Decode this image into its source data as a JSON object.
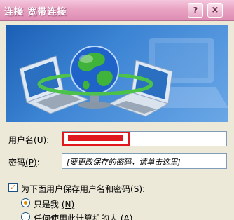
{
  "window": {
    "title": "连接 宽带连接",
    "help_label": "?",
    "close_label": "×"
  },
  "form": {
    "username_label": "用户名",
    "username_hotkey": "(U)",
    "username_value": "",
    "password_label": "密码",
    "password_hotkey": "(P)",
    "password_placeholder": "[要更改保存的密码，请单击这里]",
    "save_checkbox_label": "为下面用户保存用户名和密码",
    "save_checkbox_hotkey": "(S)",
    "save_checked": true,
    "radio_me_label": "只是我",
    "radio_me_hotkey": "(N)",
    "radio_anyone_label": "任何使用此计算机的人",
    "radio_anyone_hotkey": "(A)"
  },
  "colors": {
    "title_bar": "#e9a3c3",
    "banner": "#2f74c8",
    "highlight_red": "#e0181e"
  }
}
